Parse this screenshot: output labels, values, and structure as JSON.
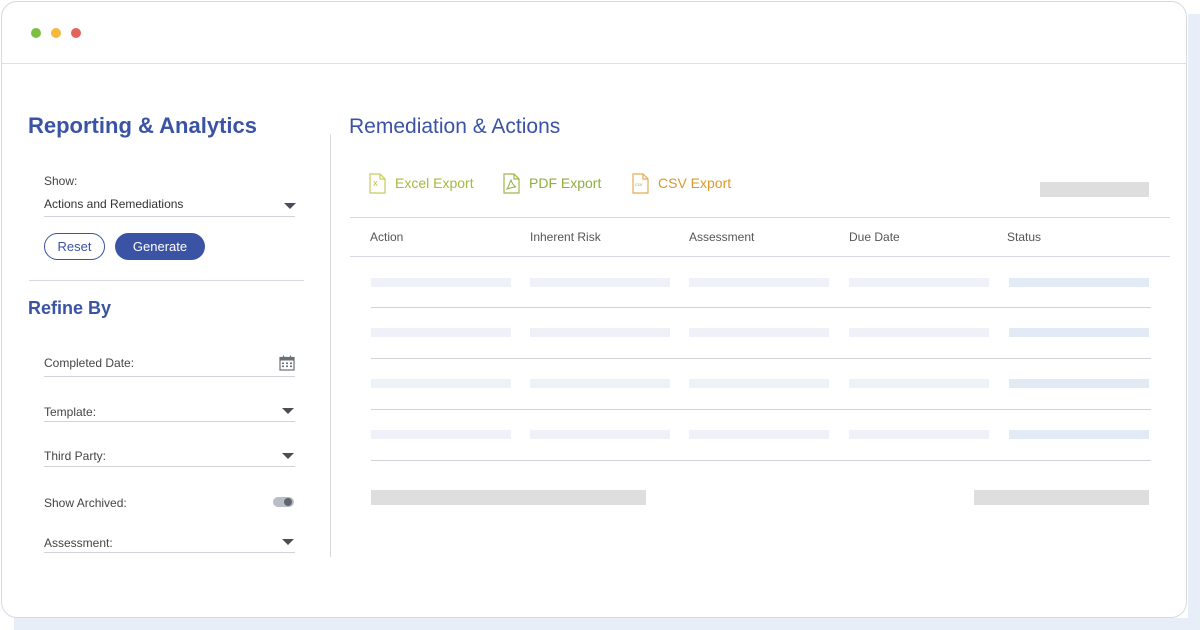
{
  "sidebar": {
    "title": "Reporting & Analytics",
    "show_label": "Show:",
    "show_value": "Actions and Remediations",
    "reset_label": "Reset",
    "generate_label": "Generate",
    "refine_title": "Refine By",
    "filters": {
      "completed_date": "Completed Date:",
      "template": "Template:",
      "third_party": "Third Party:",
      "show_archived": "Show Archived:",
      "assessment": "Assessment:"
    }
  },
  "main": {
    "title": "Remediation & Actions",
    "exports": {
      "excel": "Excel Export",
      "pdf": "PDF Export",
      "csv": "CSV Export"
    },
    "columns": [
      "Action",
      "Inherent Risk",
      "Assessment",
      "Due Date",
      "Status"
    ]
  },
  "colors": {
    "brand_blue": "#3a53a4",
    "excel_color": "#a8b93b",
    "pdf_color": "#8fae3e",
    "csv_color": "#d99a2b"
  },
  "icons": [
    "window-dot-green",
    "window-dot-yellow",
    "window-dot-red",
    "chevron-down-icon",
    "calendar-icon",
    "excel-file-icon",
    "pdf-file-icon",
    "csv-file-icon",
    "toggle-switch"
  ]
}
